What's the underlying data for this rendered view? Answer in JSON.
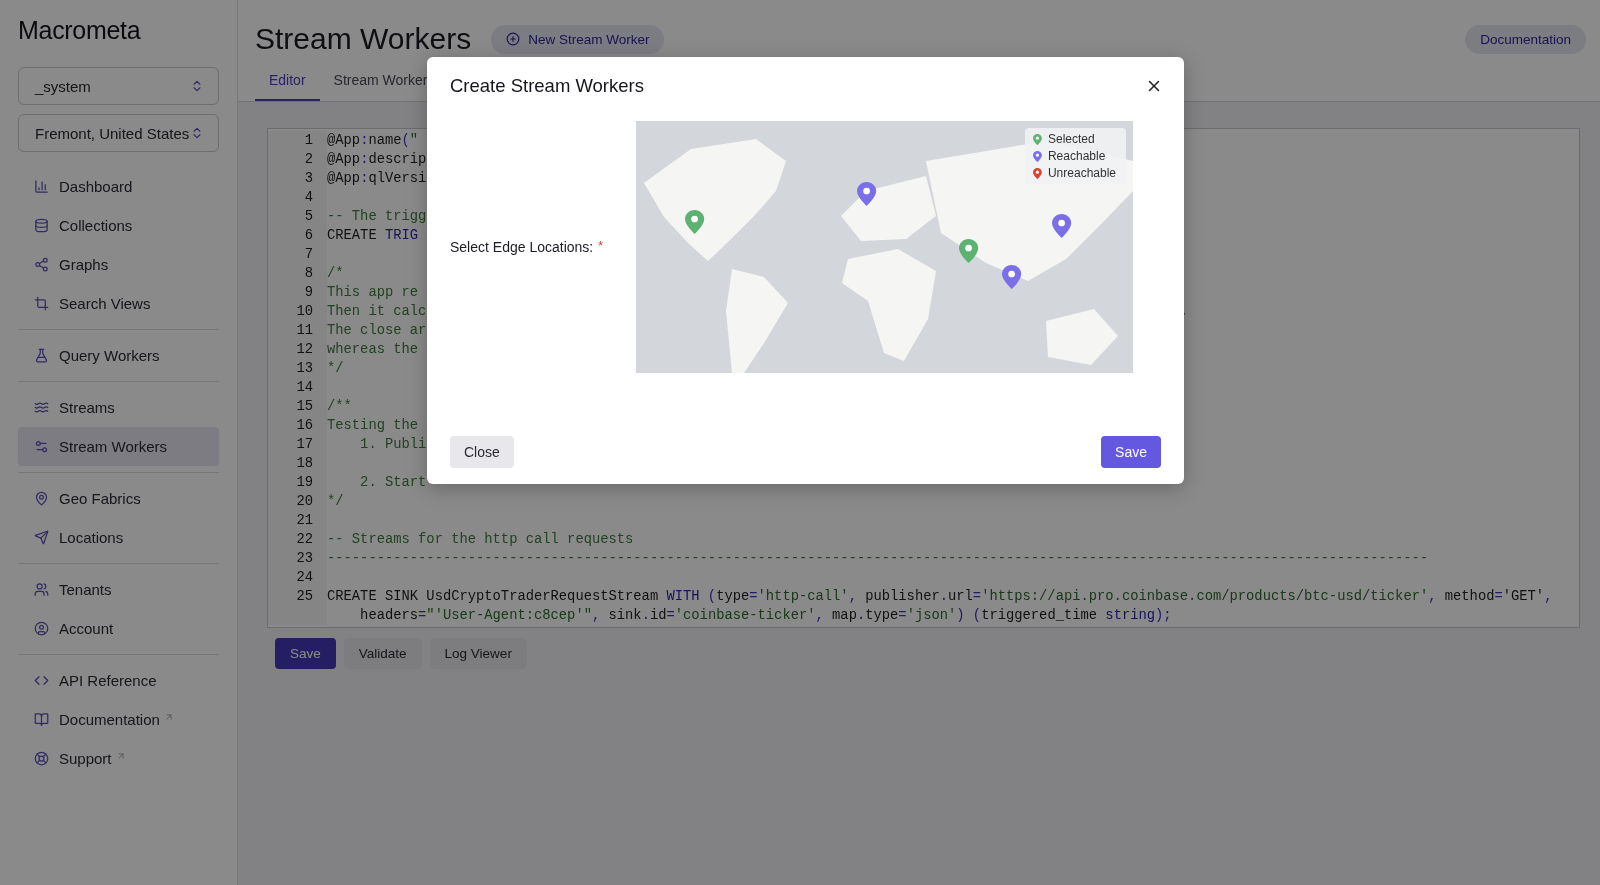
{
  "sidebar": {
    "logo": "Macrometa",
    "selectors": [
      {
        "value": "_system"
      },
      {
        "value": "Fremont, United States"
      }
    ],
    "groups": [
      {
        "items": [
          {
            "label": "Dashboard",
            "selected": false,
            "external": false
          },
          {
            "label": "Collections",
            "selected": false,
            "external": false
          },
          {
            "label": "Graphs",
            "selected": false,
            "external": false
          },
          {
            "label": "Search Views",
            "selected": false,
            "external": false
          }
        ]
      },
      {
        "items": [
          {
            "label": "Query Workers",
            "selected": false,
            "external": false
          }
        ]
      },
      {
        "items": [
          {
            "label": "Streams",
            "selected": false,
            "external": false
          },
          {
            "label": "Stream Workers",
            "selected": true,
            "external": false
          }
        ]
      },
      {
        "items": [
          {
            "label": "Geo Fabrics",
            "selected": false,
            "external": false
          },
          {
            "label": "Locations",
            "selected": false,
            "external": false
          }
        ]
      },
      {
        "items": [
          {
            "label": "Tenants",
            "selected": false,
            "external": false
          },
          {
            "label": "Account",
            "selected": false,
            "external": false
          }
        ]
      },
      {
        "items": [
          {
            "label": "API Reference",
            "selected": false,
            "external": false
          },
          {
            "label": "Documentation",
            "selected": false,
            "external": true
          },
          {
            "label": "Support",
            "selected": false,
            "external": true
          }
        ]
      }
    ]
  },
  "header": {
    "title": "Stream Workers",
    "new_button": "New Stream Worker",
    "doc_button": "Documentation"
  },
  "tabs": [
    {
      "label": "Editor",
      "selected": true
    },
    {
      "label": "Stream Worker",
      "selected": false
    }
  ],
  "editor": {
    "lines": [
      {
        "number": "1",
        "tokens": [
          {
            "kind": "text",
            "text": "@App"
          },
          {
            "kind": "punct",
            "text": ":"
          },
          {
            "kind": "text",
            "text": "name"
          },
          {
            "kind": "punct",
            "text": "("
          },
          {
            "kind": "string",
            "text": "\""
          }
        ]
      },
      {
        "number": "2",
        "tokens": [
          {
            "kind": "text",
            "text": "@App"
          },
          {
            "kind": "punct",
            "text": ":"
          },
          {
            "kind": "text",
            "text": "descrip"
          }
        ]
      },
      {
        "number": "3",
        "tokens": [
          {
            "kind": "text",
            "text": "@App"
          },
          {
            "kind": "punct",
            "text": ":"
          },
          {
            "kind": "text",
            "text": "qlVersi"
          }
        ]
      },
      {
        "number": "4"
      },
      {
        "number": "5",
        "tokens": [
          {
            "kind": "comment",
            "text": "-- The trigg"
          }
        ]
      },
      {
        "number": "6",
        "tokens": [
          {
            "kind": "text",
            "text": "CREATE "
          },
          {
            "kind": "keyword",
            "text": "TRIG"
          }
        ]
      },
      {
        "number": "7"
      },
      {
        "number": "8",
        "tokens": [
          {
            "kind": "comment",
            "text": "/*"
          }
        ]
      },
      {
        "number": "9",
        "tokens": [
          {
            "kind": "comment",
            "text": "This app re"
          }
        ]
      },
      {
        "number": "10",
        "tokens": [
          {
            "kind": "comment",
            "text": "Then it calc"
          }
        ],
        "tail": "."
      },
      {
        "number": "11",
        "tokens": [
          {
            "kind": "comment",
            "text": "The close ar"
          }
        ]
      },
      {
        "number": "12",
        "tokens": [
          {
            "kind": "comment",
            "text": "whereas the"
          }
        ]
      },
      {
        "number": "13",
        "tokens": [
          {
            "kind": "comment",
            "text": "*/"
          }
        ]
      },
      {
        "number": "14"
      },
      {
        "number": "15",
        "tokens": [
          {
            "kind": "comment",
            "text": "/**"
          }
        ]
      },
      {
        "number": "16",
        "tokens": [
          {
            "kind": "comment",
            "text": "Testing the"
          }
        ]
      },
      {
        "number": "17",
        "tokens": [
          {
            "kind": "comment",
            "text": "    1. Publi"
          }
        ]
      },
      {
        "number": "18"
      },
      {
        "number": "19",
        "tokens": [
          {
            "kind": "comment",
            "text": "    2. Start"
          }
        ]
      },
      {
        "number": "20",
        "tokens": [
          {
            "kind": "comment",
            "text": "*/"
          }
        ]
      },
      {
        "number": "21"
      },
      {
        "number": "22",
        "tokens": [
          {
            "kind": "comment",
            "text": "-- Streams for the http call requests"
          }
        ]
      },
      {
        "number": "23",
        "tokens": [
          {
            "kind": "comment",
            "text": "-------------------------------------------------------------------------------------------------------------------------------------"
          }
        ]
      },
      {
        "number": "24"
      },
      {
        "number": "25",
        "tokens": [
          {
            "kind": "text",
            "text": "CREATE SINK UsdCryptoTraderRequestStream "
          },
          {
            "kind": "keyword",
            "text": "WITH"
          },
          {
            "kind": "punct",
            "text": " ("
          },
          {
            "kind": "text",
            "text": "type"
          },
          {
            "kind": "punct",
            "text": "="
          },
          {
            "kind": "string",
            "text": "'http-call'"
          },
          {
            "kind": "punct",
            "text": ", "
          },
          {
            "kind": "text",
            "text": "publisher"
          },
          {
            "kind": "punct",
            "text": "."
          },
          {
            "kind": "text",
            "text": "url"
          },
          {
            "kind": "punct",
            "text": "="
          },
          {
            "kind": "string",
            "text": "'https://api.pro.coinbase.com/products/btc-usd/ticker'"
          },
          {
            "kind": "punct",
            "text": ", "
          },
          {
            "kind": "text",
            "text": "method"
          },
          {
            "kind": "punct",
            "text": "="
          },
          {
            "kind": "text",
            "text": "'GET'"
          },
          {
            "kind": "punct",
            "text": ","
          }
        ]
      },
      {
        "tokens": [
          {
            "kind": "text",
            "text": "    headers"
          },
          {
            "kind": "punct",
            "text": "="
          },
          {
            "kind": "string",
            "text": "\"'User-Agent:c8cep'\""
          },
          {
            "kind": "punct",
            "text": ", "
          },
          {
            "kind": "text",
            "text": "sink"
          },
          {
            "kind": "punct",
            "text": "."
          },
          {
            "kind": "text",
            "text": "id"
          },
          {
            "kind": "punct",
            "text": "="
          },
          {
            "kind": "string",
            "text": "'coinbase-ticker'"
          },
          {
            "kind": "punct",
            "text": ", "
          },
          {
            "kind": "text",
            "text": "map"
          },
          {
            "kind": "punct",
            "text": "."
          },
          {
            "kind": "text",
            "text": "type"
          },
          {
            "kind": "punct",
            "text": "="
          },
          {
            "kind": "string",
            "text": "'json'"
          },
          {
            "kind": "punct",
            "text": ") ("
          },
          {
            "kind": "text",
            "text": "triggered_time "
          },
          {
            "kind": "keyword",
            "text": "string"
          },
          {
            "kind": "punct",
            "text": ");"
          }
        ]
      }
    ]
  },
  "editor_buttons": [
    {
      "label": "Save",
      "kind": "primary"
    },
    {
      "label": "Validate",
      "kind": "secondary"
    },
    {
      "label": "Log Viewer",
      "kind": "secondary"
    }
  ],
  "modal": {
    "title": "Create Stream Workers",
    "field_label": "Select Edge Locations:",
    "required_mark": "*",
    "map": {
      "kind": "picture",
      "legend": [
        {
          "label": "Selected",
          "color": "#5cb270"
        },
        {
          "label": "Reachable",
          "color": "#7a6fe8"
        },
        {
          "label": "Unreachable",
          "color": "#d9432f"
        }
      ],
      "markers": [
        {
          "color": "#5cb270"
        },
        {
          "color": "#7a6fe8"
        },
        {
          "color": "#5cb270"
        },
        {
          "color": "#7a6fe8"
        },
        {
          "color": "#7a6fe8"
        }
      ]
    },
    "buttons": [
      {
        "label": "Close",
        "kind": "secondary"
      },
      {
        "label": "Save",
        "kind": "primary"
      }
    ]
  }
}
